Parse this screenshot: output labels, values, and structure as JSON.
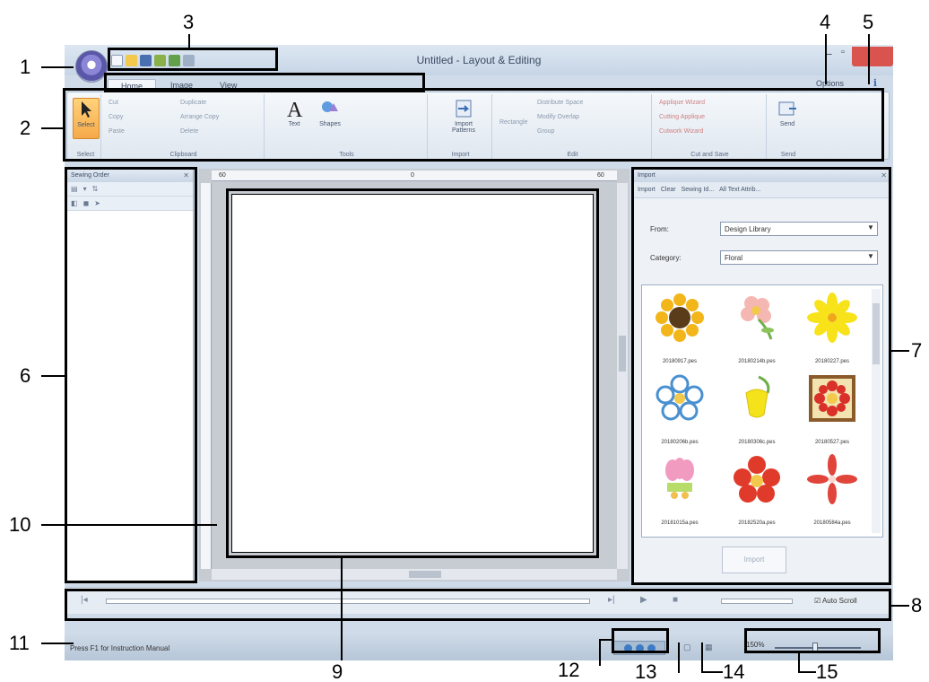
{
  "callouts": {
    "c1": "1",
    "c2": "2",
    "c3": "3",
    "c4": "4",
    "c5": "5",
    "c6": "6",
    "c7": "7",
    "c8": "8",
    "c9": "9",
    "c10": "10",
    "c11": "11",
    "c12": "12",
    "c13": "13",
    "c14": "14",
    "c15": "15"
  },
  "window": {
    "title": "Untitled - Layout & Editing",
    "min_icon": "minimize-icon",
    "max_icon": "maximize-icon",
    "close_icon": "close-icon"
  },
  "tabs": [
    "Home",
    "Image",
    "View"
  ],
  "options_label": "Options",
  "ribbon": {
    "select": {
      "label": "Select",
      "group": "Select"
    },
    "clipboard": {
      "items": [
        "Cut",
        "Copy",
        "Paste",
        "Duplicate",
        "Arrange Copy",
        "Delete"
      ],
      "group": "Clipboard"
    },
    "tools": {
      "text": "Text",
      "shapes": "Shapes",
      "group": "Tools"
    },
    "import": {
      "label": "Import Patterns",
      "group": "Import"
    },
    "edit": {
      "items": [
        "Rectangle",
        "Distribute Space",
        "Modify Overlap",
        "Group"
      ],
      "group": "Edit"
    },
    "cutsave": {
      "items": [
        "Applique Wizard",
        "Cutting Applique",
        "Cutwork Wizard"
      ],
      "group": "Cut and Save"
    },
    "save": {
      "label": "Send",
      "group": "Send"
    }
  },
  "sewing_order": {
    "title": "Sewing Order"
  },
  "ruler": {
    "num_start": "60",
    "num_mid": "0",
    "num_end": "60"
  },
  "import_panel": {
    "title": "Import",
    "tabs": [
      "Import",
      "Clear",
      "Sewing Id...",
      "All Text Attrib..."
    ],
    "from_label": "From:",
    "from_value": "Design Library",
    "category_label": "Category:",
    "category_value": "Floral",
    "thumbnails": [
      "20180917.pes",
      "20180214b.pes",
      "20180227.pes",
      "20180206b.pes",
      "20180306c.pes",
      "20180527.pes",
      "20181015a.pes",
      "20182520a.pes",
      "20180584a.pes"
    ],
    "import_button": "Import"
  },
  "playbar": {
    "autoscroll": "Auto Scroll"
  },
  "status": {
    "text": "Press F1 for Instruction Manual",
    "zoom": "150%"
  },
  "colors": {
    "accent": "#d9534f",
    "ribbon_bg": "#e8eef5"
  }
}
